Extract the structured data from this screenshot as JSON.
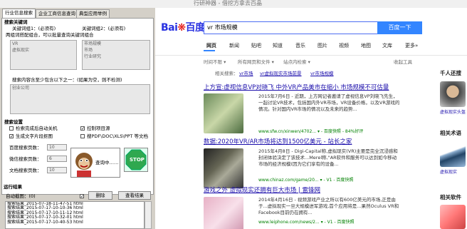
{
  "window": {
    "title": "行研神器 - 借挖方拿去百晶"
  },
  "tabs": [
    "行业信息搜索",
    "企业工商信息查询",
    "典型应用举例"
  ],
  "keywords": {
    "section": "搜索关键词",
    "kw1_label": "关键词组1：(必须有)",
    "kw2_label": "关键词组2：(必须有)",
    "hint": "两组词搭配组合，可以批量查询关键词组合",
    "kw1_lines": [
      "VR",
      "虚拟现实"
    ],
    "kw2_lines": [
      "市场规模",
      "市场",
      "行业研究"
    ],
    "exclude_label": "搜索内容含至少包含以下之一：(如果为空，则不检测)",
    "exclude_value": "创业公司"
  },
  "settings": {
    "section": "搜索设置",
    "opt1": "检索完成后自动关机",
    "opt2": "控制项目源",
    "opt3": "生成文字片段抠图",
    "opt4": "搜PDF\\DOC\\XLS\\PPT 等文档",
    "pages_baidu_label": "百度搜索页数：",
    "pages_baidu": "10",
    "pages_wechat_label": "微信搜索页数：",
    "pages_wechat": "6",
    "pages_doc_label": "文档搜索页数：",
    "pages_doc": "10",
    "searching": "查询中……",
    "stop": "STOP"
  },
  "run": {
    "section": "运行结果",
    "auto_label": "自动截图：(0)",
    "delete_button": "删除",
    "view_button": "查看结果",
    "results": [
      "搜索结果_2015-07-18-11-47-51 html",
      "搜索结果_2015-07-17-10-10-36 html",
      "搜索结果_2015-07-17-10-11-12 html",
      "搜索结果_2015-07-17-10-32-01 html",
      "搜索结果_2015-07-17-10-40-53 html"
    ]
  },
  "baidu": {
    "logo_a": "Bai",
    "logo_b": "百度",
    "query": "vr 市场规模",
    "search_button": "百度一下",
    "nav": [
      "网页",
      "新闻",
      "贴吧",
      "知道",
      "音乐",
      "图片",
      "视频",
      "地图",
      "文库",
      "更多»"
    ],
    "filter": [
      "时间不限 ▾",
      "所有网页和文件 ▾",
      "站点内检索 ▾"
    ],
    "filter_right": "收起工具",
    "related_label": "相关搜索：",
    "related": [
      "vr市场",
      "vr虚拟现实市场前景",
      "vr市场规模"
    ],
    "results": [
      {
        "title": "上方宣:虚视信息VP对晓飞 中外VR产品美市在缩小 市场规模不可估量",
        "abs": "2015年7月6日 - 近期，上方网记者邀请了虚视信息VP刘晓飞先生，一起讨论VR技术，包括国内外VR市场，VR设备价格，以及VR游戏的情况。针对国内VR市场的情况以及未来的趋势...",
        "url": "www.sfw.cn/xinwen/4702... ▾ - 百度快照 - 84%好评"
      },
      {
        "title": "数据:2020年VR/AR市场将达到1500亿美元 - 站长之家",
        "abs": "2015年4月8日 - Digi-Capital称,虚拟现实(VR)主要是完全沉浸感和封闭体验决定了该技术...Merel称,\"AR软件和服务可以达到如今移动市场的经济规模(因为它们享有的设备...",
        "url": "www.chinaz.com/game/20... ▾ - V1 - 百度快照"
      },
      {
        "title": "游戏之外 虚拟现实还拥有巨大市场 | 雷锋网",
        "abs": "2014年4月16日 - 视频游戏产业之所以有600亿美元的市场,正是由于...虚拟现实一旦大规模进军游戏,首个应用将是...果然Oculus VR和Facebook目前仍在拥有...",
        "url": "www.leiphone.com/news/2... ▾ - V1 - 百度快照"
      }
    ],
    "side_title1": "千人还搜",
    "side_cap1": "虚拟现实头盔",
    "side_title2": "相关术语",
    "side_cap2": "虚拟现实",
    "side_title3": "相关软件"
  }
}
